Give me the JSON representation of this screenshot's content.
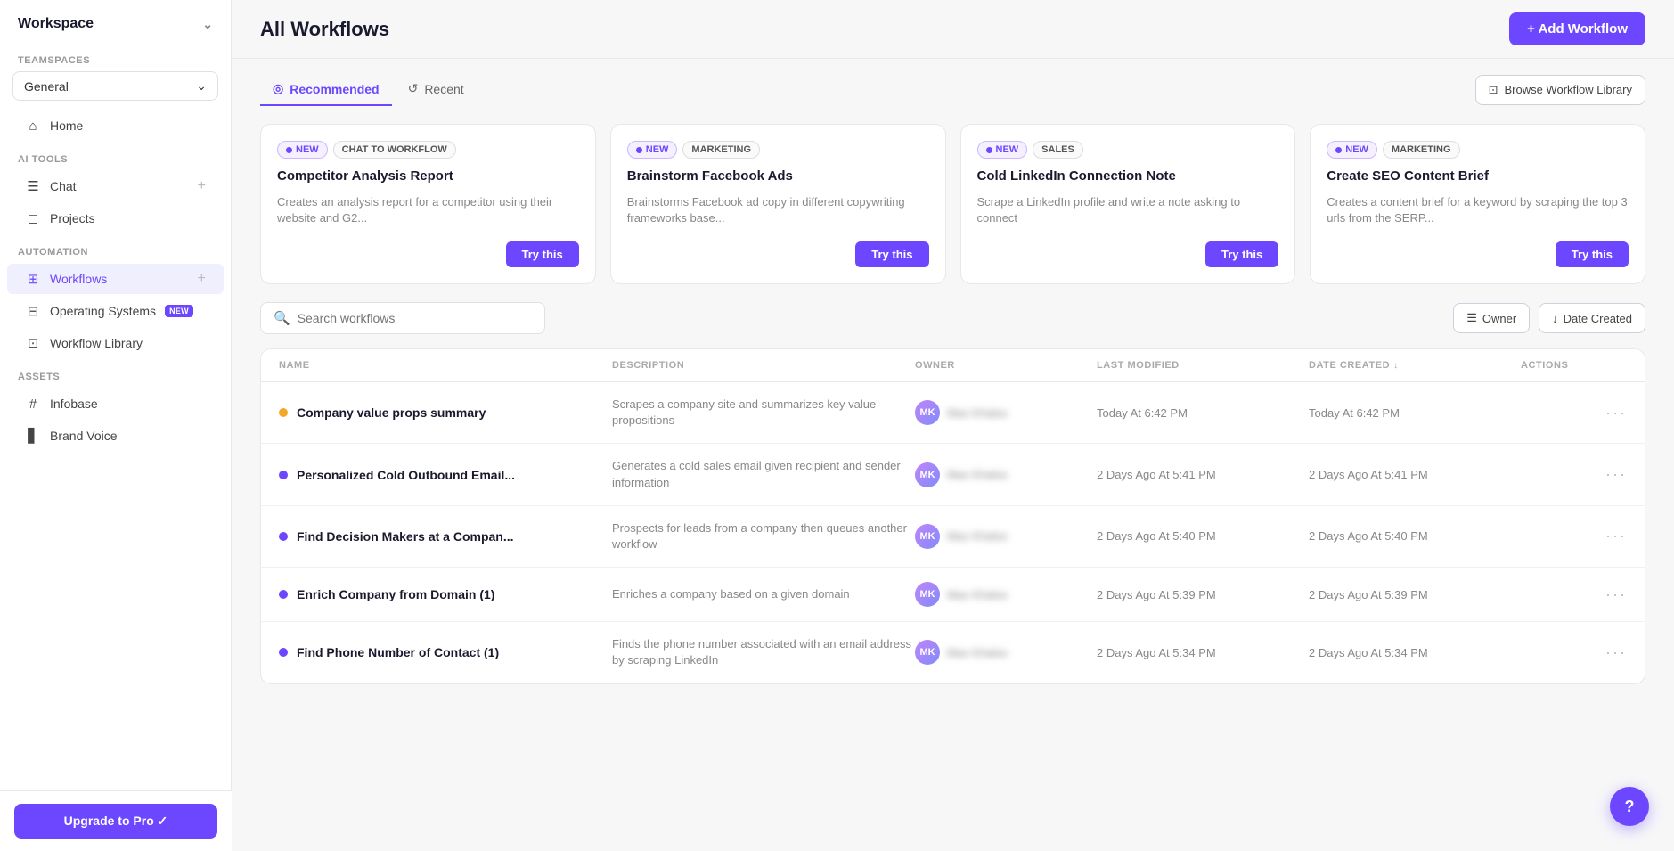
{
  "sidebar": {
    "workspace_label": "Workspace",
    "teamspaces_label": "Teamspaces",
    "teamspace_value": "General",
    "nav": {
      "home_label": "Home",
      "ai_tools_label": "AI Tools",
      "chat_label": "Chat",
      "projects_label": "Projects",
      "automation_label": "Automation",
      "workflows_label": "Workflows",
      "operating_systems_label": "Operating Systems",
      "operating_systems_badge": "NEW",
      "workflow_library_label": "Workflow Library",
      "assets_label": "Assets",
      "infobase_label": "Infobase",
      "brand_voice_label": "Brand Voice"
    },
    "upgrade_btn_label": "Upgrade to Pro ✓"
  },
  "header": {
    "title": "All Workflows",
    "add_btn_label": "+ Add Workflow"
  },
  "tabs": {
    "recommended_label": "Recommended",
    "recent_label": "Recent",
    "browse_library_label": "Browse Workflow Library"
  },
  "cards": [
    {
      "badge_new": "NEW",
      "badge_type": "CHAT TO WORKFLOW",
      "title": "Competitor Analysis Report",
      "desc": "Creates an analysis report for a competitor using their website and G2...",
      "try_label": "Try this"
    },
    {
      "badge_new": "NEW",
      "badge_type": "MARKETING",
      "title": "Brainstorm Facebook Ads",
      "desc": "Brainstorms Facebook ad copy in different copywriting frameworks base...",
      "try_label": "Try this"
    },
    {
      "badge_new": "NEW",
      "badge_type": "SALES",
      "title": "Cold LinkedIn Connection Note",
      "desc": "Scrape a LinkedIn profile and write a note asking to connect",
      "try_label": "Try this"
    },
    {
      "badge_new": "NEW",
      "badge_type": "MARKETING",
      "title": "Create SEO Content Brief",
      "desc": "Creates a content brief for a keyword by scraping the top 3 urls from the SERP...",
      "try_label": "Try this"
    }
  ],
  "search": {
    "placeholder": "Search workflows"
  },
  "filters": {
    "owner_label": "Owner",
    "date_created_label": "Date Created"
  },
  "table": {
    "columns": {
      "name": "NAME",
      "description": "DESCRIPTION",
      "owner": "OWNER",
      "last_modified": "LAST MODIFIED",
      "date_created": "DATE CREATED",
      "actions": "ACTIONS"
    },
    "rows": [
      {
        "status": "yellow",
        "name": "Company value props summary",
        "desc": "Scrapes a company site and summarizes key value propositions",
        "owner": "MK",
        "last_modified": "Today At 6:42 PM",
        "date_created": "Today At 6:42 PM"
      },
      {
        "status": "purple",
        "name": "Personalized Cold Outbound Email...",
        "desc": "Generates a cold sales email given recipient and sender information",
        "owner": "MK",
        "last_modified": "2 Days Ago At 5:41 PM",
        "date_created": "2 Days Ago At 5:41 PM"
      },
      {
        "status": "purple",
        "name": "Find Decision Makers at a Compan...",
        "desc": "Prospects for leads from a company then queues another workflow",
        "owner": "MK",
        "last_modified": "2 Days Ago At 5:40 PM",
        "date_created": "2 Days Ago At 5:40 PM"
      },
      {
        "status": "purple",
        "name": "Enrich Company from Domain (1)",
        "desc": "Enriches a company based on a given domain",
        "owner": "MK",
        "last_modified": "2 Days Ago At 5:39 PM",
        "date_created": "2 Days Ago At 5:39 PM"
      },
      {
        "status": "purple",
        "name": "Find Phone Number of Contact (1)",
        "desc": "Finds the phone number associated with an email address by scraping LinkedIn",
        "owner": "MK",
        "last_modified": "2 Days Ago At 5:34 PM",
        "date_created": "2 Days Ago At 5:34 PM"
      }
    ]
  }
}
